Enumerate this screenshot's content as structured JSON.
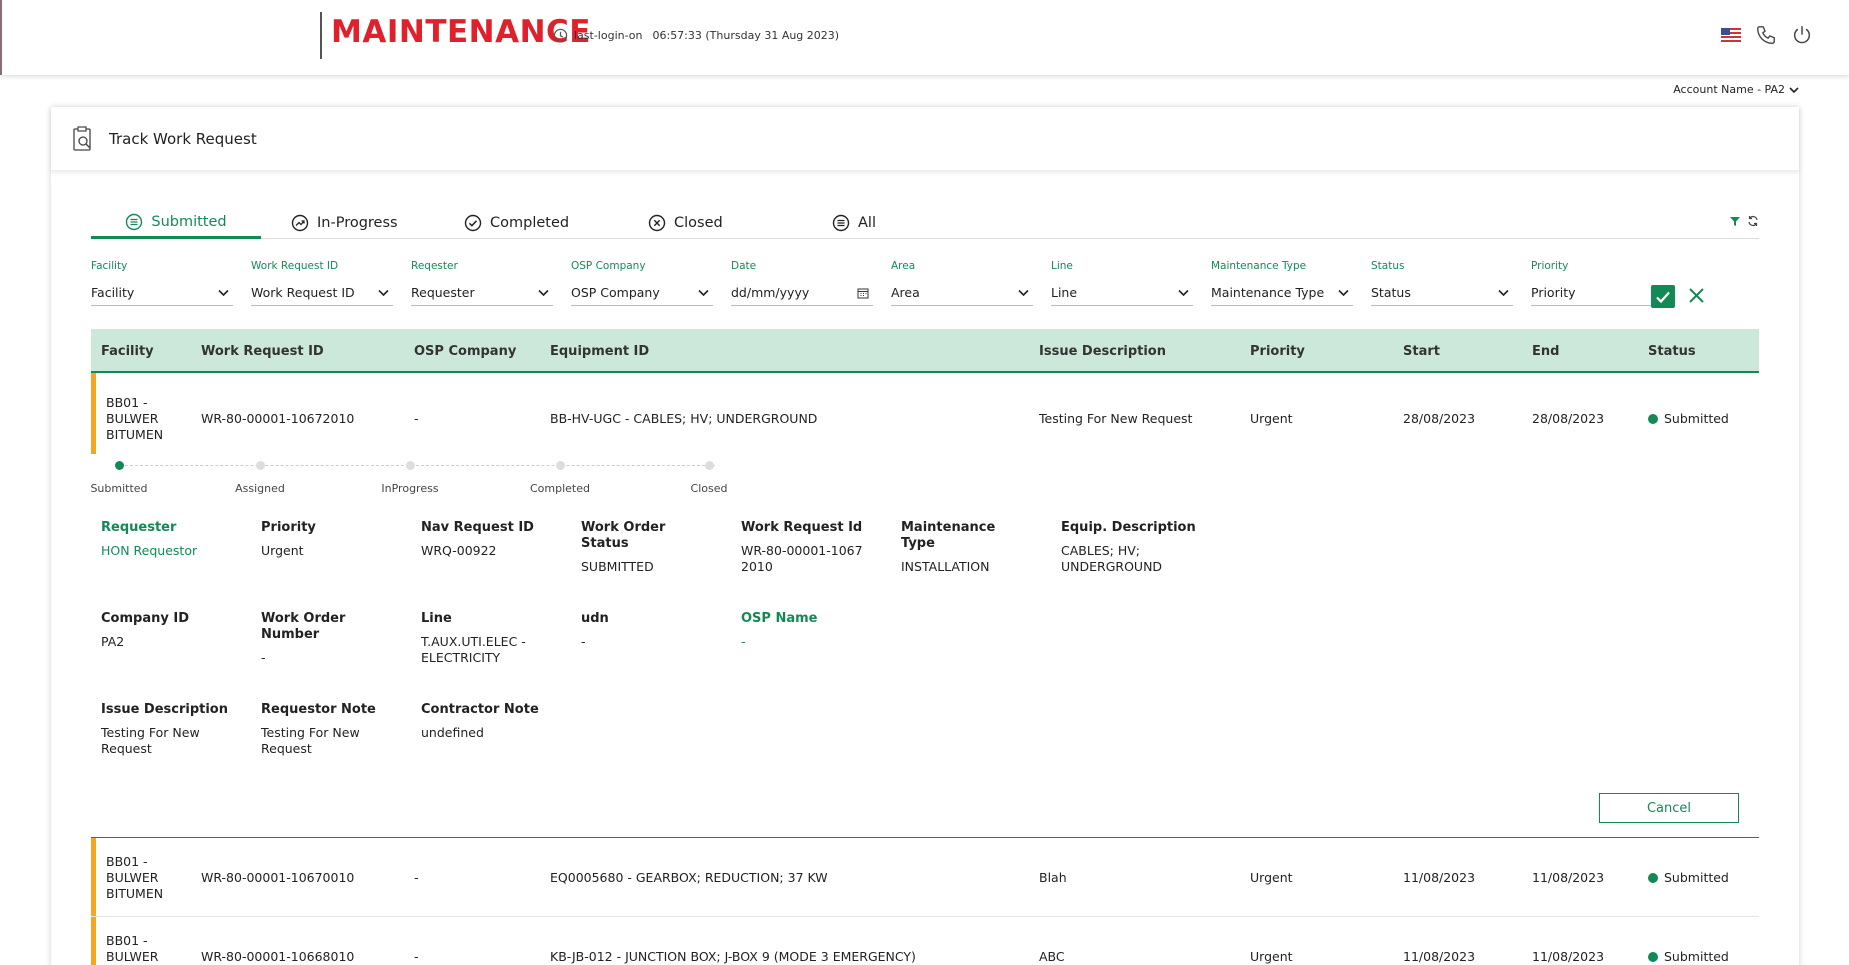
{
  "header": {
    "brand": "MAINTENANCE",
    "login_label": "last-login-on",
    "login_time": "06:57:33 (Thursday 31 Aug 2023)"
  },
  "account": {
    "label": "Account Name - PA2"
  },
  "page": {
    "title": "Track Work Request"
  },
  "tabs": [
    {
      "label": "Submitted",
      "icon": "list-circle-icon",
      "active": true
    },
    {
      "label": "In-Progress",
      "icon": "trend-circle-icon"
    },
    {
      "label": "Completed",
      "icon": "check-circle-icon"
    },
    {
      "label": "Closed",
      "icon": "x-circle-icon"
    },
    {
      "label": "All",
      "icon": "list-circle-icon"
    }
  ],
  "filters": [
    {
      "label": "Facility",
      "value": "Facility"
    },
    {
      "label": "Work Request ID",
      "value": "Work Request ID"
    },
    {
      "label": "Reqester",
      "value": "Requester"
    },
    {
      "label": "OSP Company",
      "value": "OSP Company"
    },
    {
      "label": "Date",
      "value": "dd/mm/yyyy"
    },
    {
      "label": "Area",
      "value": "Area"
    },
    {
      "label": "Line",
      "value": "Line"
    },
    {
      "label": "Maintenance Type",
      "value": "Maintenance Type"
    },
    {
      "label": "Status",
      "value": "Status"
    },
    {
      "label": "Priority",
      "value": "Priority"
    }
  ],
  "table": {
    "columns": [
      "Facility",
      "Work Request ID",
      "OSP Company",
      "Equipment ID",
      "Issue Description",
      "Priority",
      "Start",
      "End",
      "Status"
    ],
    "rows": [
      {
        "facility": [
          "BB01 -",
          "BULWER",
          "BITUMEN"
        ],
        "wr_id": "WR-80-00001-10672010",
        "osp": "-",
        "equipment": "BB-HV-UGC - CABLES; HV; UNDERGROUND",
        "issue": "Testing For New Request",
        "priority": "Urgent",
        "start": "28/08/2023",
        "end": "28/08/2023",
        "status": "Submitted"
      },
      {
        "facility": [
          "BB01 -",
          "BULWER",
          "BITUMEN"
        ],
        "wr_id": "WR-80-00001-10670010",
        "osp": "-",
        "equipment": "EQ0005680 - GEARBOX; REDUCTION; 37 KW",
        "issue": "Blah",
        "priority": "Urgent",
        "start": "11/08/2023",
        "end": "11/08/2023",
        "status": "Submitted"
      },
      {
        "facility": [
          "BB01 -",
          "BULWER"
        ],
        "wr_id": "WR-80-00001-10668010",
        "osp": "-",
        "equipment": "KB-JB-012 - JUNCTION BOX; J-BOX 9 (MODE 3 EMERGENCY)",
        "issue": "ABC",
        "priority": "Urgent",
        "start": "11/08/2023",
        "end": "11/08/2023",
        "status": "Submitted"
      }
    ]
  },
  "progress": {
    "steps": [
      "Submitted",
      "Assigned",
      "InProgress",
      "Completed",
      "Closed"
    ],
    "current": 1
  },
  "details": {
    "requester_label": "Requester",
    "requester": "HON Requestor",
    "priority_label": "Priority",
    "priority": "Urgent",
    "nav_label": "Nav Request ID",
    "nav": "WRQ-00922",
    "wos_label": "Work Order Status",
    "wos": "SUBMITTED",
    "wrid_label": "Work Request Id",
    "wrid": "WR-80-00001-1067 2010",
    "mtype_label": "Maintenance Type",
    "mtype": "INSTALLATION",
    "equip_label": "Equip. Description",
    "equip": "CABLES; HV; UNDERGROUND",
    "company_label": "Company ID",
    "company": "PA2",
    "won_label": "Work Order Number",
    "won": "-",
    "line_label": "Line",
    "line": "T.AUX.UTI.ELEC - ELECTRICITY",
    "udn_label": "udn",
    "udn": "-",
    "osp_label": "OSP Name",
    "osp": "-",
    "issue_label": "Issue Description",
    "issue": "Testing For New Request",
    "rnote_label": "Requestor Note",
    "rnote": "Testing For New Request",
    "cnote_label": "Contractor Note",
    "cnote": "undefined"
  },
  "buttons": {
    "cancel": "Cancel"
  },
  "colors": {
    "brand": "#e0202a",
    "accent": "#138a55",
    "row_marker": "#f5a623",
    "header_bg": "#cce8da"
  }
}
